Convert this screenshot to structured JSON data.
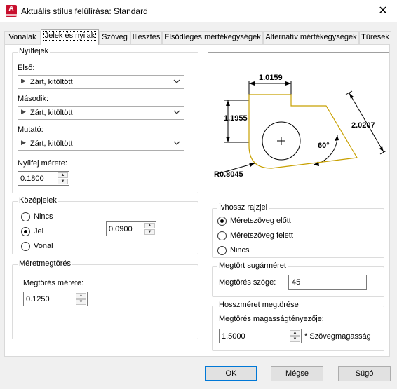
{
  "window": {
    "title": "Aktuális stílus felülírása: Standard",
    "app_icon_letter": "A"
  },
  "tabs": [
    {
      "label": "Vonalak"
    },
    {
      "label": "Jelek és nyilak"
    },
    {
      "label": "Szöveg"
    },
    {
      "label": "Illesztés"
    },
    {
      "label": "Elsődleges mértékegységek"
    },
    {
      "label": "Alternatív mértékegységek"
    },
    {
      "label": "Tűrések"
    }
  ],
  "arrowheads": {
    "title": "Nyílfejek",
    "first_label": "Első:",
    "first_value": "Zárt, kitöltött",
    "second_label": "Második:",
    "second_value": "Zárt, kitöltött",
    "leader_label": "Mutató:",
    "leader_value": "Zárt, kitöltött",
    "size_label": "Nyílfej mérete:",
    "size_value": "0.1800"
  },
  "center_marks": {
    "title": "Középjelek",
    "options": [
      "Nincs",
      "Jel",
      "Vonal"
    ],
    "selected": "Jel",
    "size_value": "0.0900"
  },
  "dimension_break": {
    "title": "Méretmegtörés",
    "size_label": "Megtörés mérete:",
    "size_value": "0.1250"
  },
  "arc_length": {
    "title": "Ívhossz rajzjel",
    "options": [
      "Méretszöveg előtt",
      "Méretszöveg felett",
      "Nincs"
    ],
    "selected": "Méretszöveg előtt"
  },
  "radius_jog": {
    "title": "Megtört sugárméret",
    "angle_label": "Megtörés szöge:",
    "angle_value": "45"
  },
  "linear_jog": {
    "title": "Hosszméret megtörése",
    "factor_label": "Megtörés magasságtényezője:",
    "factor_value": "1.5000",
    "factor_suffix": "* Szövegmagasság"
  },
  "preview": {
    "dim_top": "1.0159",
    "dim_left": "1.1955",
    "dim_right": "2.0207",
    "dim_angle": "60°",
    "dim_radius": "R0.8045"
  },
  "buttons": {
    "ok": "OK",
    "cancel": "Mégse",
    "help": "Súgó"
  },
  "colors": {
    "accent": "#0078d7",
    "preview_outline": "#c8a000",
    "app_icon": "#c8102e"
  }
}
